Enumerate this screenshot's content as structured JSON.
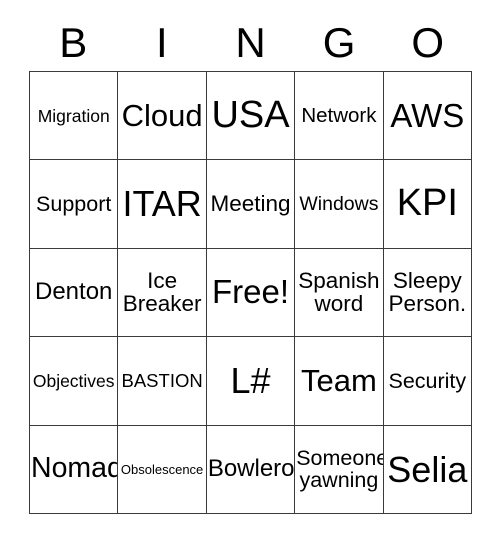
{
  "card": {
    "title_letters": [
      "B",
      "I",
      "N",
      "G",
      "O"
    ],
    "colors": {
      "background": "#ffffff",
      "text": "#000000",
      "border": "#3a3a3a"
    },
    "rows": [
      [
        {
          "text": "Migration",
          "size": "fs-17"
        },
        {
          "text": "Cloud",
          "size": "fs-31"
        },
        {
          "text": "USA",
          "size": "fs-38"
        },
        {
          "text": "Network",
          "size": "fs-20"
        },
        {
          "text": "AWS",
          "size": "fs-33"
        }
      ],
      [
        {
          "text": "Support",
          "size": "fs-21"
        },
        {
          "text": "ITAR",
          "size": "fs-36"
        },
        {
          "text": "Meeting",
          "size": "fs-22"
        },
        {
          "text": "Windows",
          "size": "fs-19"
        },
        {
          "text": "KPI",
          "size": "fs-38"
        }
      ],
      [
        {
          "text": "Denton",
          "size": "fs-24"
        },
        {
          "text": "Ice\nBreaker",
          "size": "fs-22"
        },
        {
          "text": "Free!",
          "size": "fs-33"
        },
        {
          "text": "Spanish\nword",
          "size": "fs-22"
        },
        {
          "text": "Sleepy\nPerson.",
          "size": "fs-22"
        }
      ],
      [
        {
          "text": "Objectives",
          "size": "fs-17"
        },
        {
          "text": "BASTION",
          "size": "fs-18"
        },
        {
          "text": "L#",
          "size": "fs-36"
        },
        {
          "text": "Team",
          "size": "fs-31"
        },
        {
          "text": "Security",
          "size": "fs-21"
        }
      ],
      [
        {
          "text": "Nomad",
          "size": "fs-28"
        },
        {
          "text": "Obsolescence",
          "size": "fs-13"
        },
        {
          "text": "Bowlero",
          "size": "fs-24"
        },
        {
          "text": "Someone\nyawning",
          "size": "fs-21"
        },
        {
          "text": "Selia",
          "size": "fs-36"
        }
      ]
    ]
  }
}
